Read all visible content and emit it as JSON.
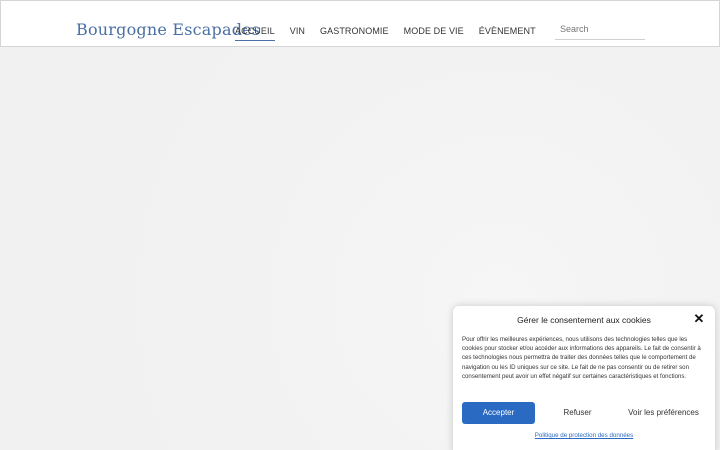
{
  "site": {
    "logo": "Bourgogne Escapades"
  },
  "nav": {
    "items": [
      {
        "label": "ACCUEIL",
        "active": true
      },
      {
        "label": "VIN",
        "active": false
      },
      {
        "label": "GASTRONOMIE",
        "active": false
      },
      {
        "label": "MODE DE VIE",
        "active": false
      },
      {
        "label": "ÉVÈNEMENT",
        "active": false
      }
    ]
  },
  "search": {
    "placeholder": "Search"
  },
  "cookie": {
    "title": "Gérer le consentement aux cookies",
    "text": "Pour offrir les meilleures expériences, nous utilisons des technologies telles que les cookies pour stocker et/ou accéder aux informations des appareils. Le fait de consentir à ces technologies nous permettra de traiter des données telles que le comportement de navigation ou les ID uniques sur ce site. Le fait de ne pas consentir ou de retirer son consentement peut avoir un effet négatif sur certaines caractéristiques et fonctions.",
    "accept_label": "Accepter",
    "refuse_label": "Refuser",
    "prefs_label": "Voir les préférences",
    "policy_link": "Politique de protection des données",
    "close_icon": "close-icon"
  },
  "colors": {
    "brand": "#4a6fa5",
    "accept_button": "#2a6ac2",
    "background": "#f2f2f2"
  }
}
